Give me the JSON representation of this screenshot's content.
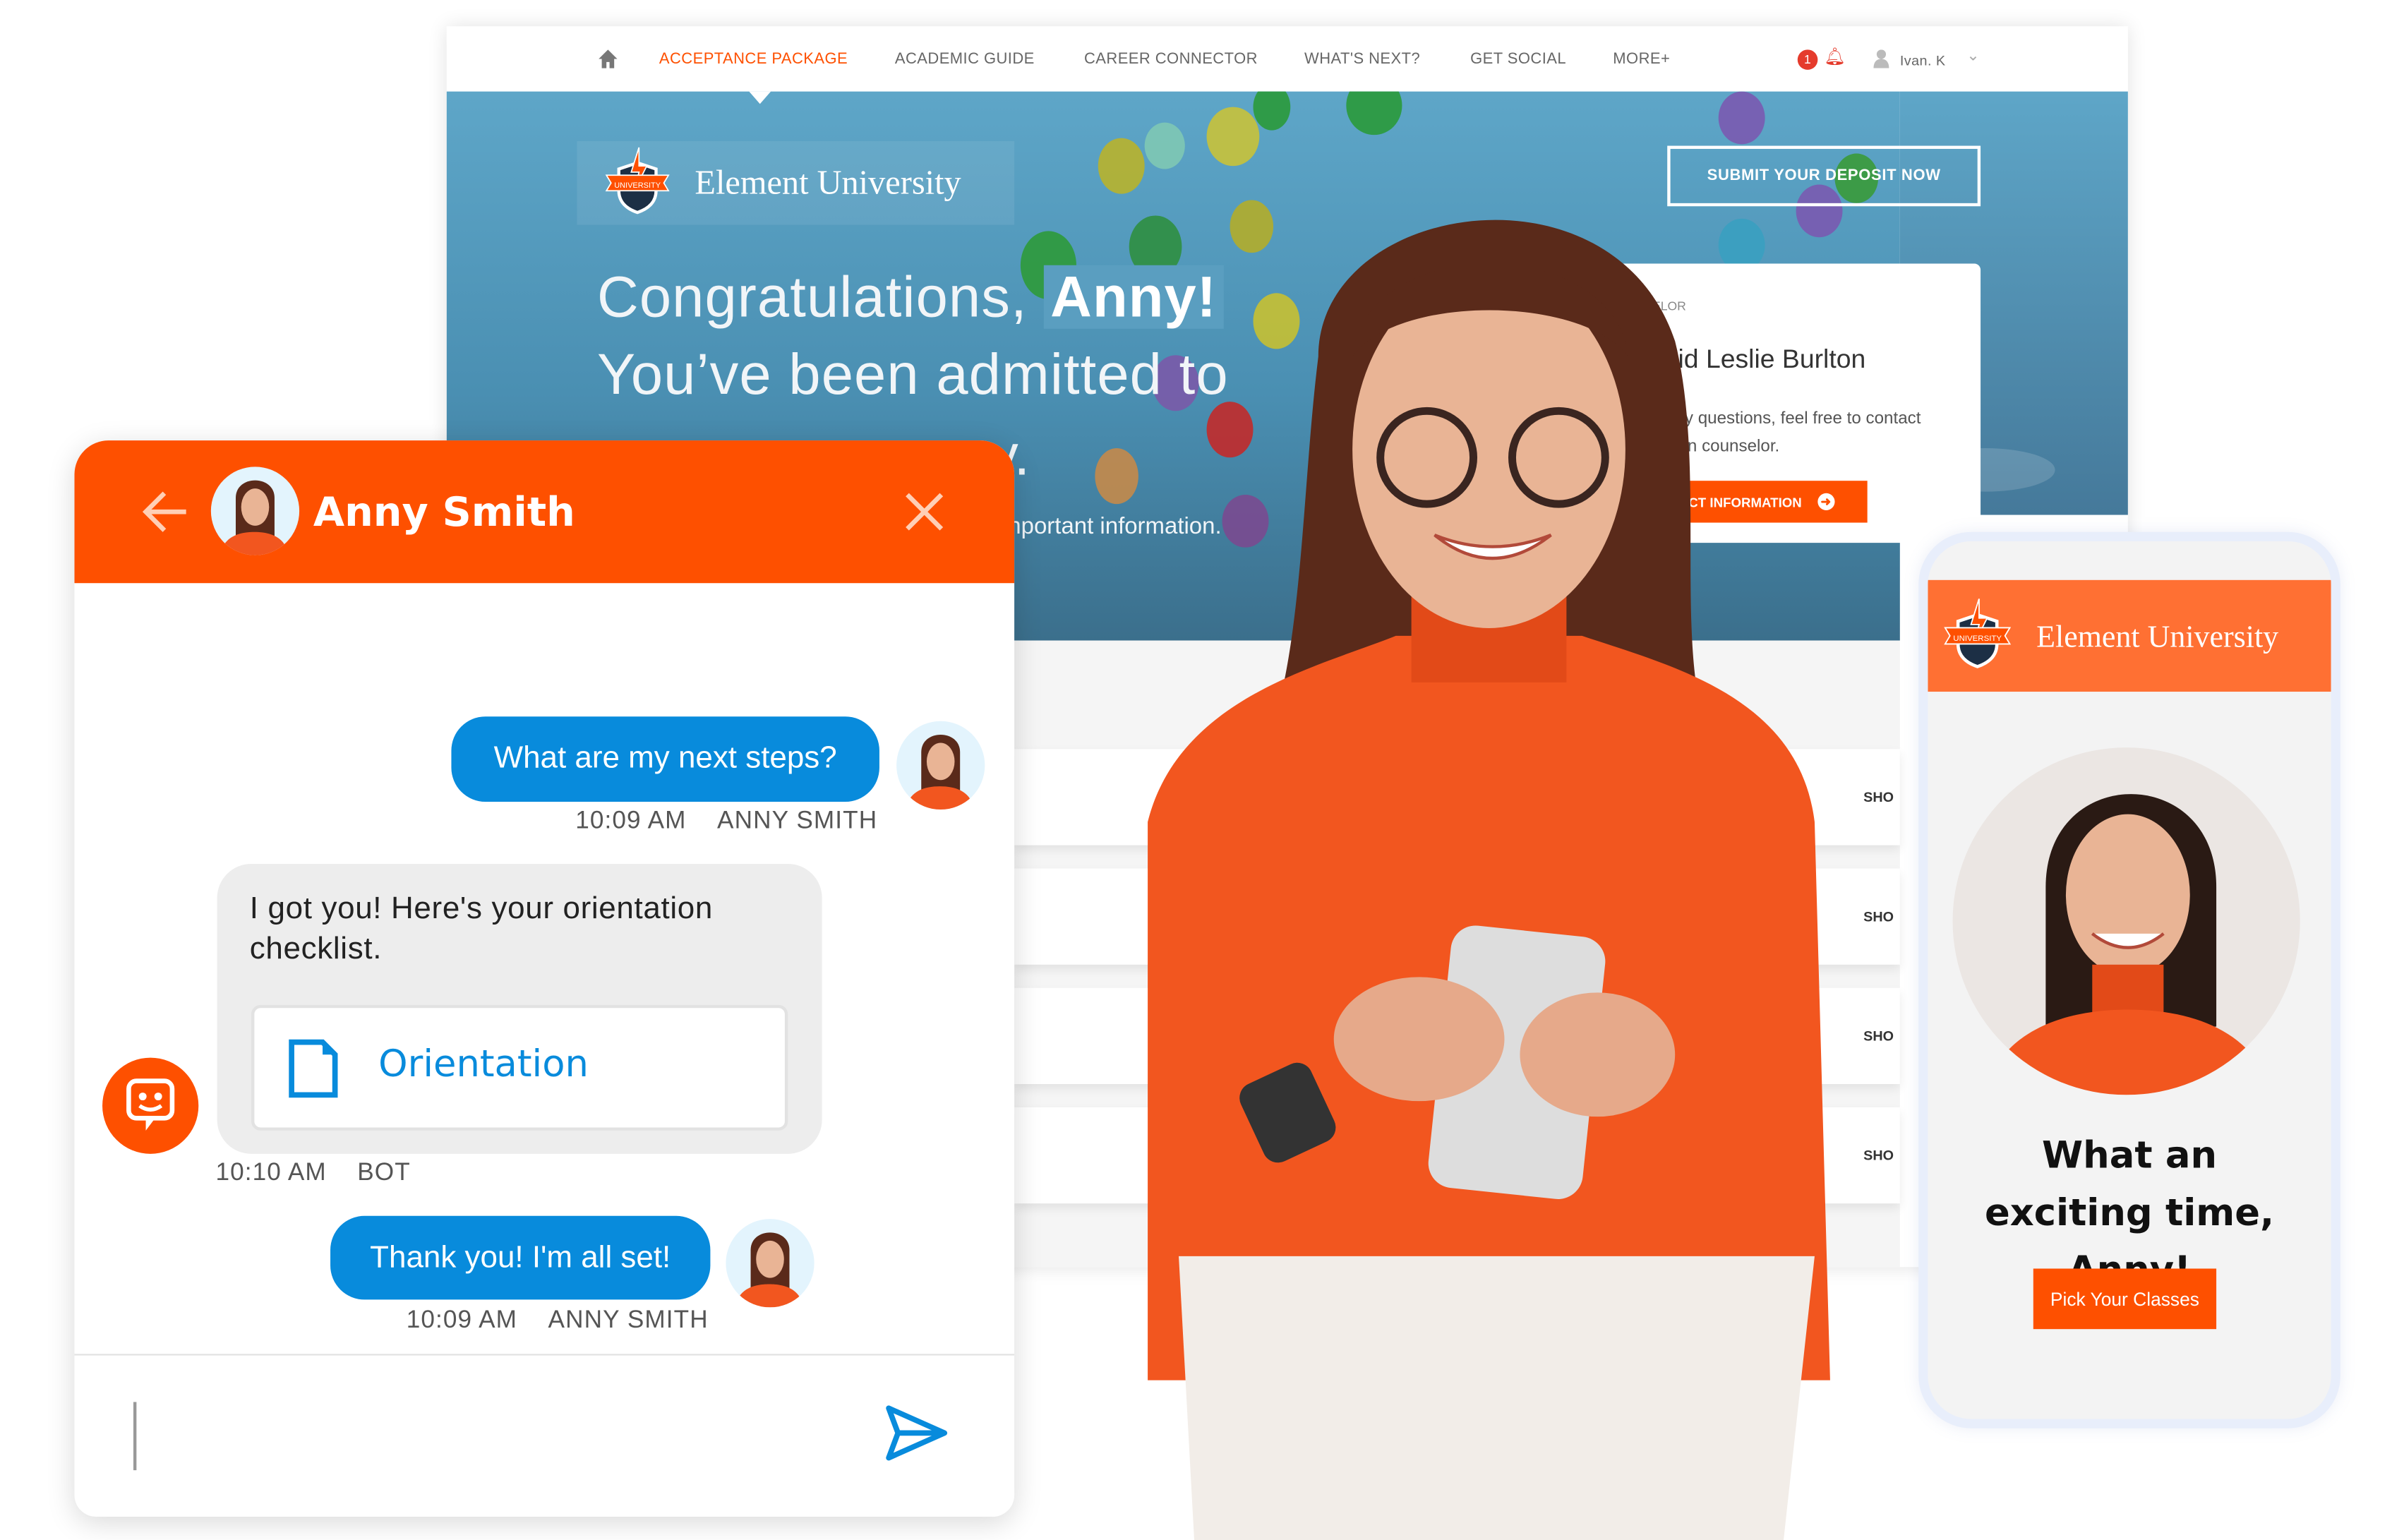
{
  "website": {
    "nav": {
      "items": [
        "ACCEPTANCE PACKAGE",
        "ACADEMIC GUIDE",
        "CAREER CONNECTOR",
        "WHAT'S NEXT?",
        "GET SOCIAL",
        "MORE+"
      ],
      "active_index": 0,
      "notification_count": "1",
      "user_name": "Ivan. K"
    },
    "brand": "Element University",
    "logo_text": "UNIVERSITY",
    "hero": {
      "line1": "Congratulations,",
      "name": "Anny!",
      "line2": "You’ve been admitted to",
      "line3_fragment": "y.",
      "info_fragment": "nportant information."
    },
    "deposit_button": "SUBMIT YOUR DEPOSIT NOW",
    "counselor": {
      "label_fragment": "SELOR",
      "name_fragment": "avid Leslie Burlton",
      "text_line1": "any questions, feel free to contact",
      "text_line2": "sion counselor.",
      "button_fragment": "TACT INFORMATION"
    },
    "row_labels": [
      "SHO",
      "SHO",
      "SHO",
      "SHO"
    ]
  },
  "chat": {
    "header_name": "Anny Smith",
    "messages": [
      {
        "text": "What are my next steps?",
        "time": "10:09 AM",
        "sender": "ANNY SMITH"
      },
      {
        "text": "I got you! Here's your orientation checklist.",
        "attachment": "Orientation",
        "time": "10:10 AM",
        "sender": "BOT"
      },
      {
        "text": "Thank you! I'm all set!",
        "time": "10:09 AM",
        "sender": "ANNY SMITH"
      }
    ],
    "input_value": ""
  },
  "phone": {
    "brand": "Element University",
    "headline": "What an exciting time, Anny!",
    "button": "Pick Your Classes"
  },
  "colors": {
    "brand_orange": "#fe5000",
    "chat_blue": "#088bdc",
    "hero_blue": "#5ea6c8",
    "phone_orange": "#ff7033"
  }
}
